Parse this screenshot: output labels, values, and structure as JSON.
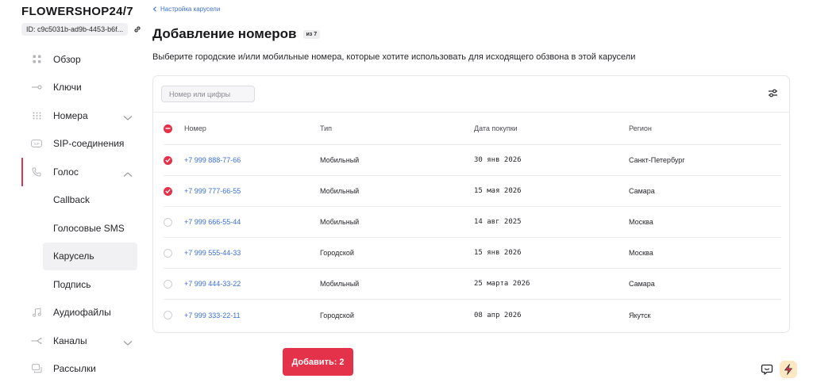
{
  "sidebar": {
    "brand": "FLOWERSHOP24/7",
    "account_id": "ID: c9c5031b-ad9b-4453-b6f...",
    "items": [
      {
        "label": "Обзор",
        "icon": "grid-icon"
      },
      {
        "label": "Ключи",
        "icon": "key-icon"
      },
      {
        "label": "Номера",
        "icon": "dialpad-icon",
        "expandable": true
      },
      {
        "label": "SIP-соединения",
        "icon": "sip-icon"
      },
      {
        "label": "Голос",
        "icon": "phone-icon",
        "expandable": true,
        "expanded": true,
        "active": true
      },
      {
        "label": "Аудиофайлы",
        "icon": "music-icon"
      },
      {
        "label": "Каналы",
        "icon": "channels-icon",
        "expandable": true
      },
      {
        "label": "Рассылки",
        "icon": "mailing-icon"
      }
    ],
    "voice_sub": [
      {
        "label": "Callback"
      },
      {
        "label": "Голосовые SMS"
      },
      {
        "label": "Карусель",
        "selected": true
      },
      {
        "label": "Подпись"
      }
    ]
  },
  "main": {
    "back_label": "Настройка карусели",
    "title": "Добавление номеров",
    "badge": "из 7",
    "subtitle": "Выберите городские и/или мобильные номера, которые хотите использовать для исходящего обзвона в этой карусели",
    "search_placeholder": "Номер или цифры",
    "columns": {
      "number": "Номер",
      "type": "Тип",
      "date": "Дата покупки",
      "region": "Регион"
    },
    "rows": [
      {
        "number": "+7 999 888-77-66",
        "type": "Мобильный",
        "date": "30 янв 2026",
        "region": "Санкт-Петербург",
        "checked": true
      },
      {
        "number": "+7 999 777-66-55",
        "type": "Мобильный",
        "date": "15 мая 2026",
        "region": "Самара",
        "checked": true
      },
      {
        "number": "+7 999 666-55-44",
        "type": "Мобильный",
        "date": "14 авг 2025",
        "region": "Москва",
        "checked": false
      },
      {
        "number": "+7 999 555-44-33",
        "type": "Городской",
        "date": "15 янв 2026",
        "region": "Москва",
        "checked": false
      },
      {
        "number": "+7 999 444-33-22",
        "type": "Мобильный",
        "date": "25 марта 2026",
        "region": "Самара",
        "checked": false
      },
      {
        "number": "+7 999 333-22-11",
        "type": "Городской",
        "date": "08 апр 2026",
        "region": "Якутск",
        "checked": false
      }
    ],
    "add_button": "Добавить: 2"
  },
  "colors": {
    "accent": "#e3324a",
    "link": "#3b6fd8"
  }
}
